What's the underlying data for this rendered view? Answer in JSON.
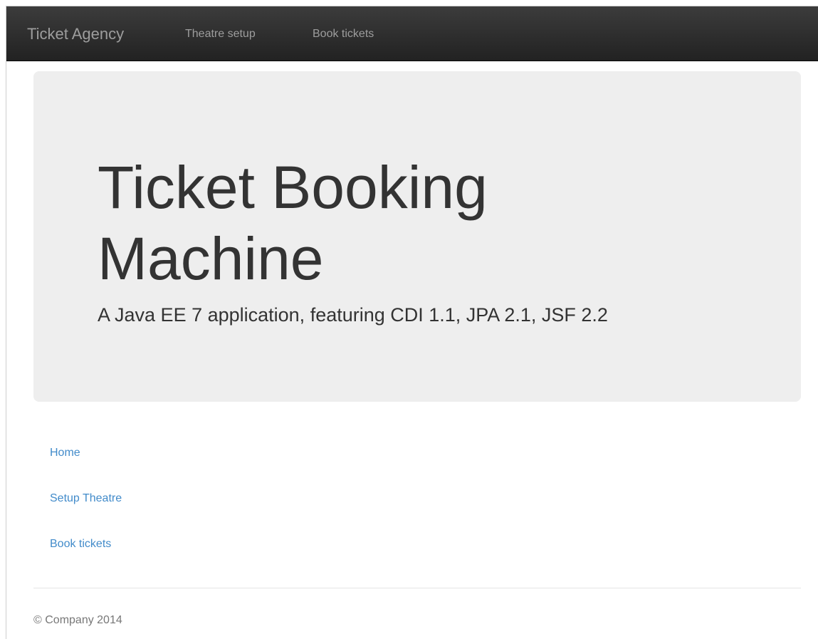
{
  "navbar": {
    "brand": "Ticket Agency",
    "links": [
      "Theatre setup",
      "Book tickets"
    ]
  },
  "jumbotron": {
    "title": "Ticket Booking Machine",
    "subtitle": "A Java EE 7 application, featuring CDI 1.1, JPA 2.1, JSF 2.2"
  },
  "main_links": [
    "Home",
    "Setup Theatre",
    "Book tickets"
  ],
  "footer": {
    "text": "© Company 2014"
  },
  "colors": {
    "navbar_bg": "#222222",
    "navbar_text": "#9d9d9d",
    "jumbotron_bg": "#eeeeee",
    "link": "#428bca",
    "footer_text": "#777777"
  }
}
